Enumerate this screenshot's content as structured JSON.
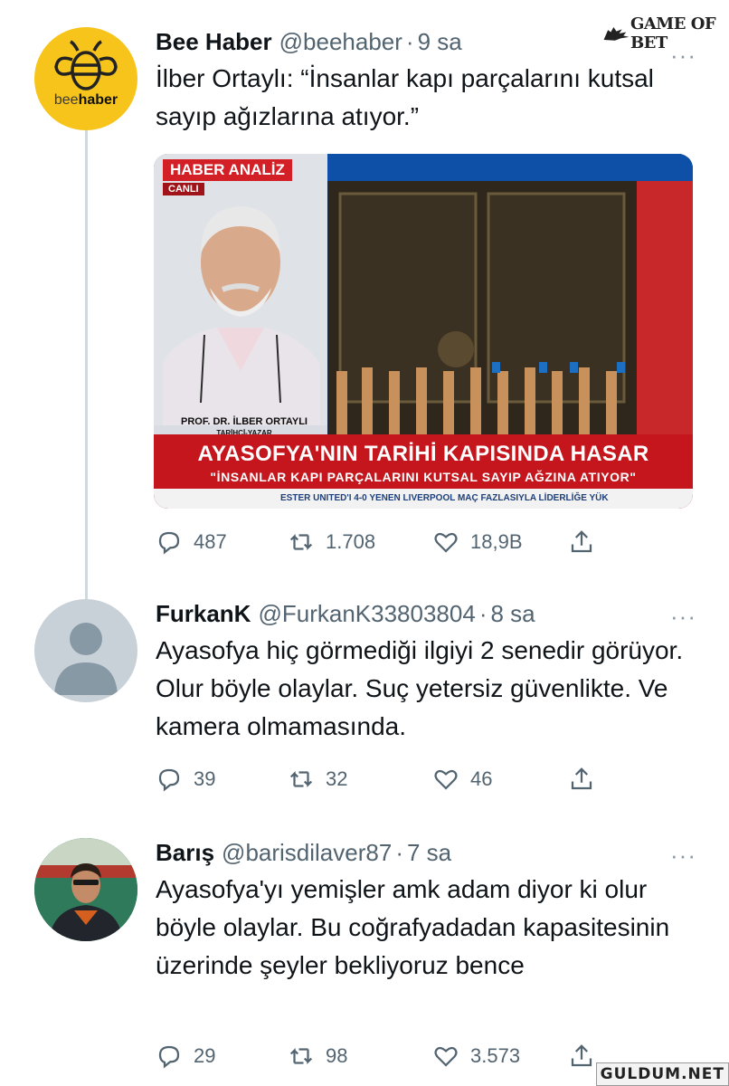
{
  "watermarks": {
    "top": "GAME OF BET",
    "bottom": "GULDUM.NET"
  },
  "tweets": [
    {
      "name": "Bee Haber",
      "handle": "@beehaber",
      "time": "9 sa",
      "avatar_label_light": "bee",
      "avatar_label_bold": "haber",
      "text": "İlber Ortaylı: “İnsanlar kapı parçalarını kutsal sayıp ağızlarına atıyor.”",
      "replies": "487",
      "retweets": "1.708",
      "likes": "18,9B",
      "media": {
        "tag_program": "HABER ANALİZ",
        "tag_live": "CANLI",
        "guest_name": "PROF. DR. İLBER ORTAYLI",
        "guest_role": "TARİHÇİ-YAZAR",
        "headline": "AYASOFYA'NIN TARİHİ KAPISINDA HASAR",
        "subline": "\"İNSANLAR KAPI PARÇALARINI KUTSAL SAYIP AĞZINA ATIYOR\"",
        "ticker": "ESTER UNITED'I 4-0 YENEN LIVERPOOL MAÇ FAZLASIYLA LİDERLİĞE YÜK"
      }
    },
    {
      "name": "FurkanK",
      "handle": "@FurkanK33803804",
      "time": "8 sa",
      "text": "Ayasofya hiç görmediği ilgiyi 2 senedir görüyor. Olur böyle olaylar. Suç yetersiz güvenlikte. Ve kamera olmamasında.",
      "replies": "39",
      "retweets": "32",
      "likes": "46"
    },
    {
      "name": "Barış",
      "handle": "@barisdilaver87",
      "time": "7 sa",
      "text": "Ayasofya'yı yemişler amk adam diyor ki olur böyle olaylar. Bu coğrafyadadan kapasitesinin üzerinde şeyler bekliyoruz bence",
      "replies": "29",
      "retweets": "98",
      "likes": "3.573"
    }
  ],
  "ui": {
    "dot": "·",
    "more": "···"
  }
}
